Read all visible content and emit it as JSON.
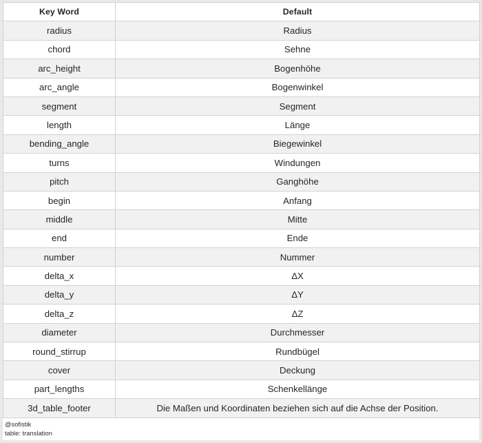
{
  "table": {
    "columns": [
      "Key Word",
      "Default"
    ],
    "rows": [
      {
        "key_word": "radius",
        "default": "Radius"
      },
      {
        "key_word": "chord",
        "default": "Sehne"
      },
      {
        "key_word": "arc_height",
        "default": "Bogenhöhe"
      },
      {
        "key_word": "arc_angle",
        "default": "Bogenwinkel"
      },
      {
        "key_word": "segment",
        "default": "Segment"
      },
      {
        "key_word": "length",
        "default": "Länge"
      },
      {
        "key_word": "bending_angle",
        "default": "Biegewinkel"
      },
      {
        "key_word": "turns",
        "default": "Windungen"
      },
      {
        "key_word": "pitch",
        "default": "Ganghöhe"
      },
      {
        "key_word": "begin",
        "default": "Anfang"
      },
      {
        "key_word": "middle",
        "default": "Mitte"
      },
      {
        "key_word": "end",
        "default": "Ende"
      },
      {
        "key_word": "number",
        "default": "Nummer"
      },
      {
        "key_word": "delta_x",
        "default": "ΔX"
      },
      {
        "key_word": "delta_y",
        "default": "ΔY"
      },
      {
        "key_word": "delta_z",
        "default": "ΔZ"
      },
      {
        "key_word": "diameter",
        "default": "Durchmesser"
      },
      {
        "key_word": "round_stirrup",
        "default": "Rundbügel"
      },
      {
        "key_word": "cover",
        "default": "Deckung"
      },
      {
        "key_word": "part_lengths",
        "default": "Schenkellänge"
      },
      {
        "key_word": "3d_table_footer",
        "default": "Die Maßen und Koordinaten beziehen sich auf die Achse der Position."
      }
    ]
  },
  "caption": {
    "line1": "@sofistik",
    "line2": "table: translation"
  },
  "colors": {
    "row_shaded": "#f1f1f1",
    "row_plain": "#ffffff",
    "border": "#d2d2d2",
    "frame": "#e9e9e9",
    "text": "#22262c"
  }
}
